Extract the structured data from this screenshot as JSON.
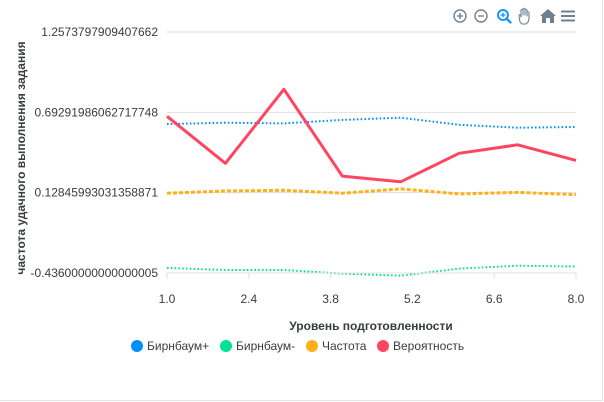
{
  "chart_data": {
    "type": "line",
    "x": [
      1,
      2,
      3,
      4,
      5,
      6,
      7,
      8
    ],
    "xticks": [
      "1.0",
      "2.4",
      "3.8",
      "5.2",
      "6.6",
      "8.0"
    ],
    "xtick_values": [
      1.0,
      2.4,
      3.8,
      5.2,
      6.6,
      8.0
    ],
    "xlim": [
      1.0,
      8.0
    ],
    "yticks": [
      "1.2573797909407662",
      "0.69291986062717748",
      "0.12845993031358871",
      "-0.43600000000000005"
    ],
    "ytick_values": [
      1.2573797909407662,
      0.6929198606271775,
      0.1284599303135887,
      -0.43600000000000005
    ],
    "ylim": [
      -0.43600000000000005,
      1.2573797909407662
    ],
    "xlabel": "Уровень подготовленности",
    "ylabel": "частота удачного выполнения задания",
    "grid": "horizontal",
    "legend_position": "bottom",
    "series": [
      {
        "name": "Бирнбаум+",
        "color": "#008ffb",
        "dash": "dotted",
        "x": [
          1,
          2,
          3,
          4,
          5,
          6,
          7,
          8
        ],
        "values": [
          0.61,
          0.62,
          0.615,
          0.64,
          0.655,
          0.605,
          0.585,
          0.59
        ]
      },
      {
        "name": "Бирнбаум-",
        "color": "#00e396",
        "dash": "dotted",
        "x": [
          1,
          2,
          3,
          4,
          5,
          6,
          7,
          8
        ],
        "values": [
          -0.4,
          -0.415,
          -0.415,
          -0.44,
          -0.455,
          -0.405,
          -0.385,
          -0.39
        ]
      },
      {
        "name": "Частота",
        "color": "#feb019",
        "dash": "dashed",
        "x": [
          1,
          2,
          3,
          4,
          5,
          6,
          7,
          8
        ],
        "values": [
          0.125,
          0.14,
          0.145,
          0.125,
          0.155,
          0.12,
          0.13,
          0.115
        ]
      },
      {
        "name": "Вероятность",
        "color": "#ff4560",
        "dash": "solid",
        "x": [
          1,
          2,
          3,
          4,
          5,
          6,
          7,
          8
        ],
        "values": [
          0.665,
          0.335,
          0.855,
          0.245,
          0.205,
          0.405,
          0.465,
          0.355
        ]
      }
    ]
  },
  "toolbar": {
    "zoom_in_icon": "zoom-in-icon",
    "zoom_out_icon": "zoom-out-icon",
    "selection_zoom_icon": "magnifier-icon",
    "pan_icon": "hand-icon",
    "reset_icon": "home-icon",
    "menu_icon": "menu-icon",
    "active_color": "#008ffb",
    "icon_color": "#6e8192"
  }
}
